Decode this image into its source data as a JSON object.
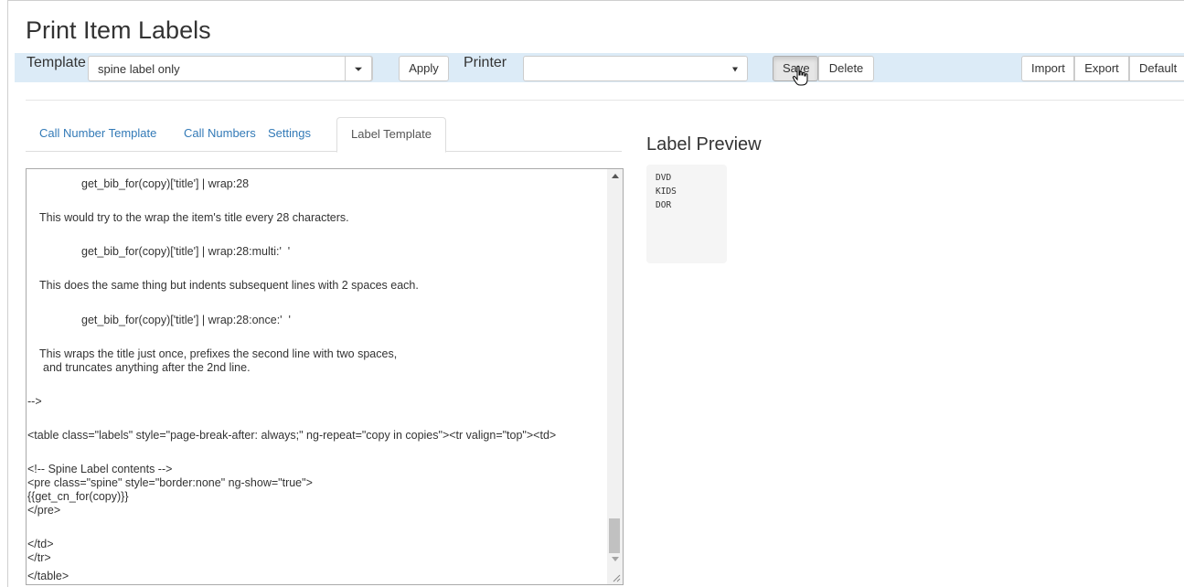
{
  "page": {
    "title": "Print Item Labels"
  },
  "toolbar": {
    "template_label": "Template",
    "template_value": "spine label only",
    "apply_label": "Apply",
    "printer_label": "Printer",
    "printer_value": "",
    "save_label": "Save",
    "delete_label": "Delete",
    "import_label": "Import",
    "export_label": "Export",
    "default_label": "Default",
    "background_color": "#dcebf7"
  },
  "tabs": [
    {
      "label": "Call Number Template",
      "active": false
    },
    {
      "label": "Call Numbers",
      "active": false
    },
    {
      "label": "Settings",
      "active": false
    },
    {
      "label": "Label Template",
      "active": true
    }
  ],
  "editor": {
    "lines": [
      "get_bib_for(copy)['title'] | wrap:28",
      "This would try to the wrap the item's title every 28 characters.",
      "get_bib_for(copy)['title'] | wrap:28:multi:'  '",
      "This does the same thing but indents subsequent lines with 2 spaces each.",
      "get_bib_for(copy)['title'] | wrap:28:once:'  '",
      "This wraps the title just once, prefixes the second line with two spaces,",
      "and truncates anything after the 2nd line.",
      "-->",
      "<table class=\"labels\" style=\"page-break-after: always;\" ng-repeat=\"copy in copies\"><tr valign=\"top\"><td>",
      "<!-- Spine Label contents -->",
      "<pre class=\"spine\" style=\"border:none\" ng-show=\"true\">",
      "{{get_cn_for(copy)}}",
      "</pre>",
      "</td>",
      "</tr>",
      "</table>"
    ]
  },
  "preview": {
    "title": "Label Preview",
    "lines": [
      "DVD",
      "KIDS",
      "DOR"
    ]
  },
  "icons": {
    "cursor": "hand-pointer-icon",
    "template_caret": "caret-down-icon",
    "printer_caret": "caret-down-icon"
  }
}
